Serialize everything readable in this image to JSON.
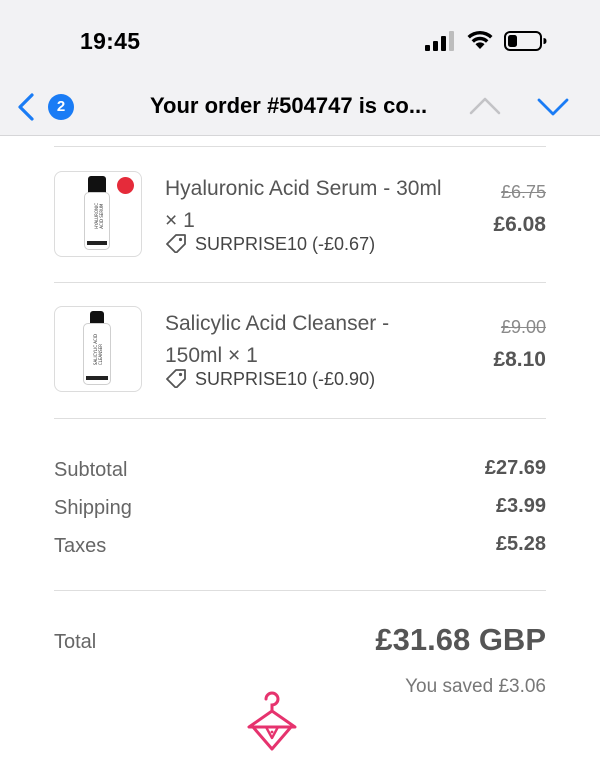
{
  "status": {
    "time": "19:45",
    "icons": [
      "cellular-signal-icon",
      "wifi-icon",
      "battery-icon"
    ]
  },
  "nav": {
    "badge_count": "2",
    "title": "Your order #504747 is co...",
    "icons": [
      "chevron-left-icon",
      "chevron-up-icon",
      "chevron-down-icon"
    ]
  },
  "items": [
    {
      "name": "Hyaluronic Acid Serum - 30ml × 1",
      "discount": "SURPRISE10 (-£0.67)",
      "old_price": "£6.75",
      "price": "£6.08"
    },
    {
      "name": "Salicylic Acid Cleanser - 150ml × 1",
      "discount": "SURPRISE10 (-£0.90)",
      "old_price": "£9.00",
      "price": "£8.10"
    }
  ],
  "summary": {
    "subtotal_label": "Subtotal",
    "subtotal": "£27.69",
    "shipping_label": "Shipping",
    "shipping": "£3.99",
    "taxes_label": "Taxes",
    "taxes": "£5.28"
  },
  "total": {
    "label": "Total",
    "value": "£31.68 GBP",
    "saved": "You saved £3.06"
  },
  "colors": {
    "accent": "#1a7cf5",
    "brand_logo": "#e6336e",
    "seal": "#e52b3a"
  }
}
